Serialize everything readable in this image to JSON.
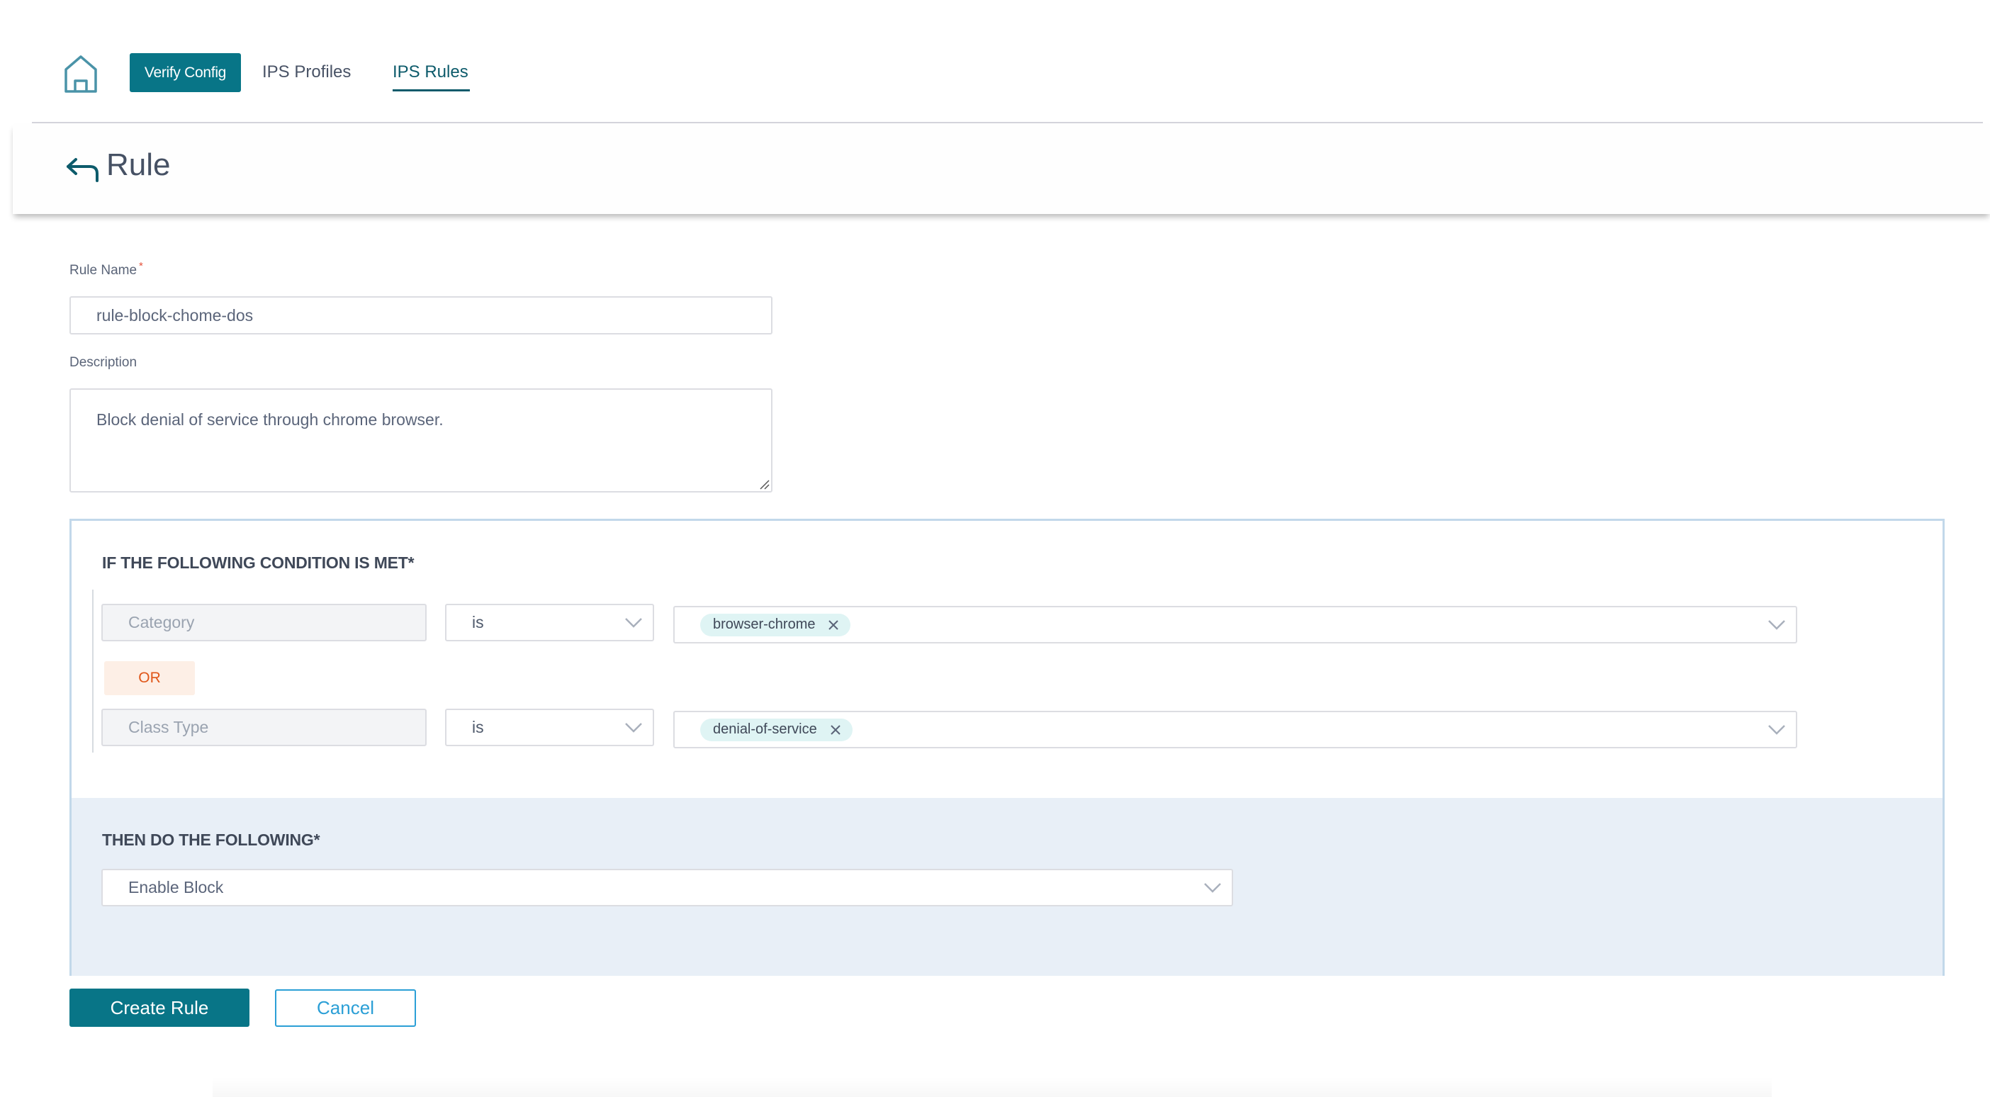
{
  "nav": {
    "home_icon": "home-icon",
    "verify_config_label": "Verify Config",
    "links": [
      {
        "label": "IPS Profiles",
        "active": false
      },
      {
        "label": "IPS Rules",
        "active": true
      }
    ]
  },
  "header": {
    "back_icon": "back-arrow-icon",
    "title": "Rule"
  },
  "form": {
    "rule_name": {
      "label": "Rule Name",
      "required_marker": "*",
      "value": "rule-block-chome-dos"
    },
    "description": {
      "label": "Description",
      "value": "Block denial of service through chrome browser."
    }
  },
  "conditions": {
    "heading": "IF THE FOLLOWING CONDITION IS MET*",
    "rows": [
      {
        "field": "Category",
        "operator": "is",
        "values": [
          "browser-chrome"
        ]
      },
      {
        "field": "Class Type",
        "operator": "is",
        "values": [
          "denial-of-service"
        ]
      }
    ],
    "joiner": "OR"
  },
  "actions": {
    "heading": "THEN DO THE FOLLOWING*",
    "selected": "Enable Block"
  },
  "buttons": {
    "create": "Create Rule",
    "cancel": "Cancel"
  },
  "colors": {
    "primary": "#087587",
    "active_link": "#0d5b6b",
    "or_badge_text": "#e0571a",
    "or_badge_bg": "#fdefe6",
    "tag_bg": "#dff4f4",
    "action_area_bg": "#e8eff7",
    "cancel_border": "#2b9fd6",
    "required": "#e5533d"
  }
}
